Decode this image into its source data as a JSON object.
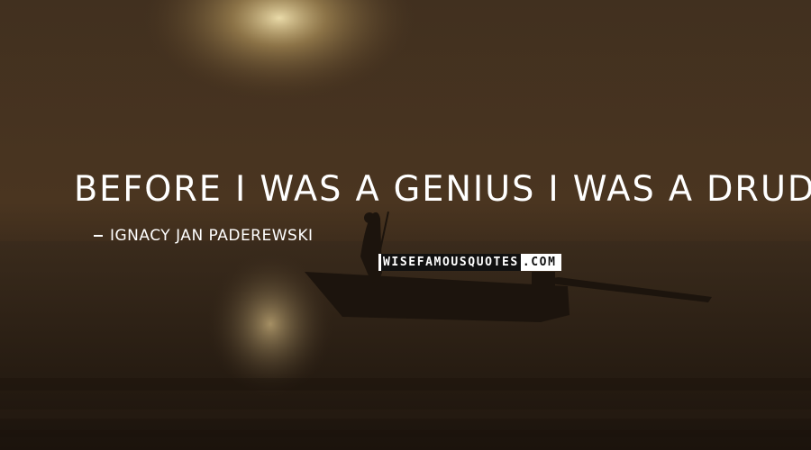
{
  "quote": {
    "text": "BEFORE I WAS A GENIUS I WAS A DRUDGE.",
    "author": "IGNACY JAN PADEREWSKI"
  },
  "watermark": {
    "part_dark": "WISEFAMOUSQUOTES",
    "part_light": ".COM"
  },
  "colors": {
    "sky_top": "#3a2a1c",
    "sky_mid": "#5a4126",
    "sun_glow": "#e9d39a",
    "sea": "#2a1f15",
    "text": "#ffffff"
  }
}
